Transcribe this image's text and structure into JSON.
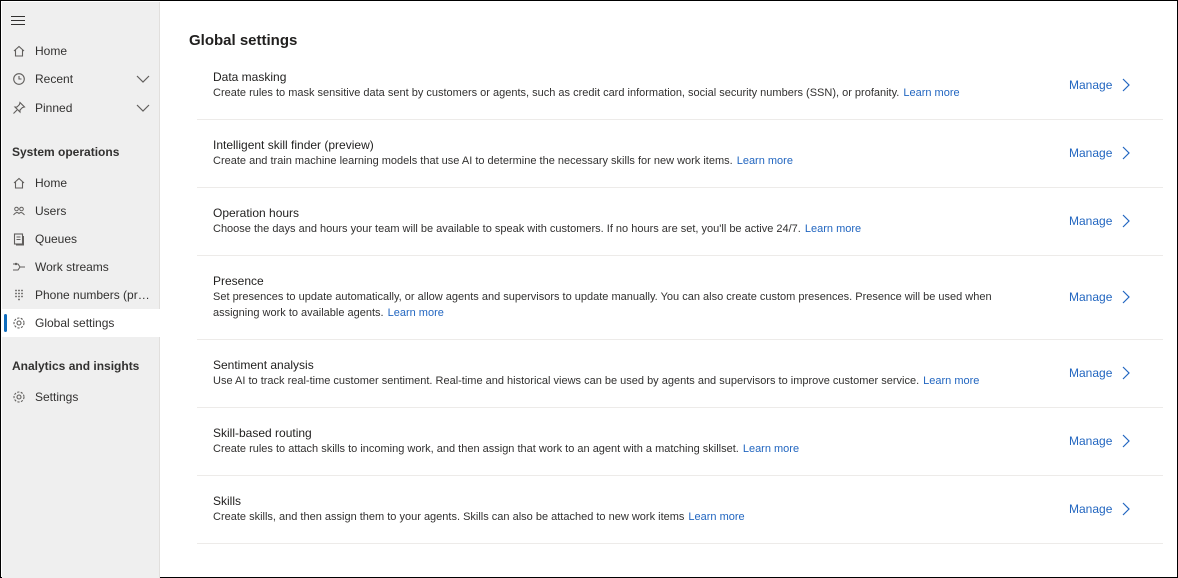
{
  "sidebar": {
    "top_items": [
      {
        "label": "Home",
        "icon": "home-icon"
      },
      {
        "label": "Recent",
        "icon": "clock-icon"
      },
      {
        "label": "Pinned",
        "icon": "pin-icon"
      }
    ],
    "sections": [
      {
        "title": "System operations",
        "items": [
          {
            "label": "Home",
            "icon": "home-icon"
          },
          {
            "label": "Users",
            "icon": "users-icon"
          },
          {
            "label": "Queues",
            "icon": "queues-icon"
          },
          {
            "label": "Work streams",
            "icon": "workstreams-icon"
          },
          {
            "label": "Phone numbers (pre...",
            "icon": "dialpad-icon"
          },
          {
            "label": "Global settings",
            "icon": "gear-icon",
            "active": true
          }
        ]
      },
      {
        "title": "Analytics and insights",
        "items": [
          {
            "label": "Settings",
            "icon": "gear-icon"
          }
        ]
      }
    ]
  },
  "main": {
    "title": "Global settings",
    "manage_label": "Manage",
    "learn_more_label": "Learn more",
    "rows": [
      {
        "title": "Data masking",
        "desc": "Create rules to mask sensitive data sent by customers or agents, such as credit card information, social security numbers (SSN), or profanity."
      },
      {
        "title": "Intelligent skill finder (preview)",
        "desc": "Create and train machine learning models that use AI to determine the necessary skills for new work items."
      },
      {
        "title": "Operation hours",
        "desc": "Choose the days and hours your team will be available to speak with customers. If no hours are set, you'll be active 24/7."
      },
      {
        "title": "Presence",
        "desc": "Set presences to update automatically, or allow agents and supervisors to update manually. You can also create custom presences. Presence will be used when assigning work to available agents."
      },
      {
        "title": "Sentiment analysis",
        "desc": "Use AI to track real-time customer sentiment. Real-time and historical views can be used by agents and supervisors to improve customer service."
      },
      {
        "title": "Skill-based routing",
        "desc": "Create rules to attach skills to incoming work, and then assign that work to an agent with a matching skillset."
      },
      {
        "title": "Skills",
        "desc": "Create skills, and then assign them to your agents. Skills can also be attached to new work items"
      }
    ]
  },
  "colors": {
    "link": "#2266c0",
    "accent": "#0f6cbd",
    "sidebar_bg": "#efefef"
  }
}
